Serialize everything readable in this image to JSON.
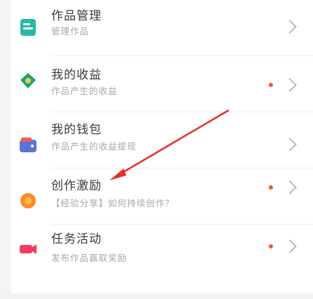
{
  "menu": {
    "items": [
      {
        "title": "作品管理",
        "subtitle": "管理作品",
        "badge": false,
        "icon": "document-icon",
        "color": "#26b9a6"
      },
      {
        "title": "我的收益",
        "subtitle": "作品产生的收益",
        "badge": true,
        "icon": "coins-icon",
        "color": "#1aa37a"
      },
      {
        "title": "我的钱包",
        "subtitle": "作品产生的收益提现",
        "badge": false,
        "icon": "wallet-icon",
        "color": "#5b74d8"
      },
      {
        "title": "创作激励",
        "subtitle": "【经验分享】如何持续创作？",
        "badge": true,
        "icon": "medal-icon",
        "color": "#ff8a2a"
      },
      {
        "title": "任务活动",
        "subtitle": "发布作品赢取奖励",
        "badge": true,
        "icon": "campaign-icon",
        "color": "#f23b5b"
      }
    ]
  },
  "annotation": {
    "color": "#e8312b"
  }
}
